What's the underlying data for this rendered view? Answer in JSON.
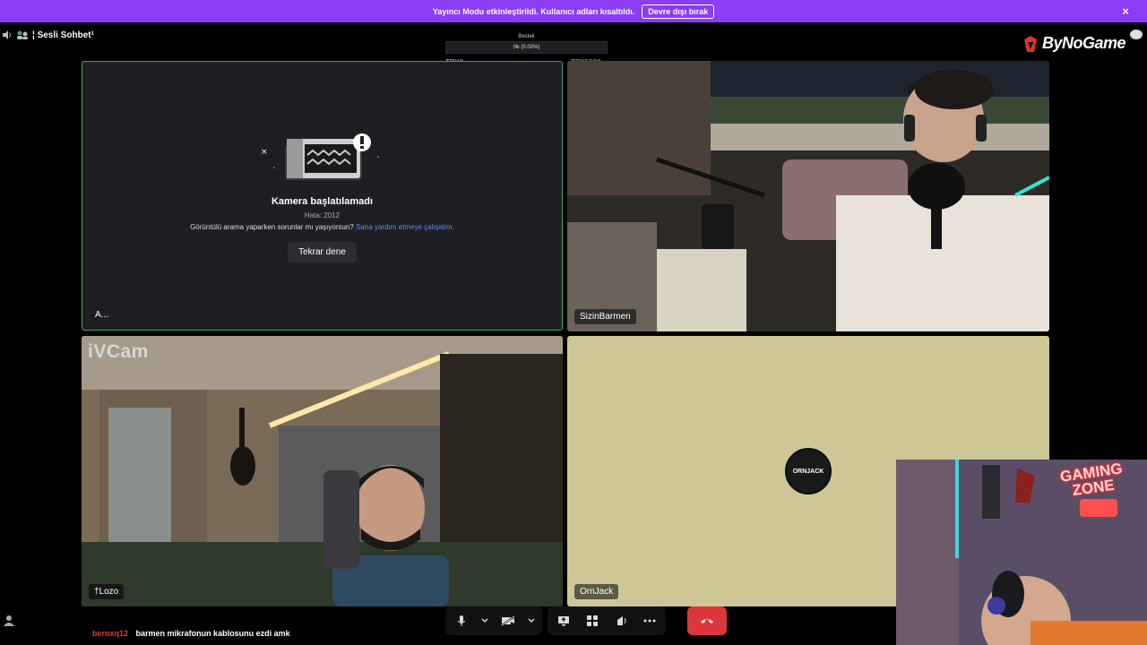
{
  "banner": {
    "text": "Yayıncı Modu etkinleştirildi. Kullanıcı adları kısaltıldı.",
    "button_label": "Devre dışı bırak",
    "close_icon": "×"
  },
  "channel": {
    "title": "¦ Sesli Sohbet¹"
  },
  "overlay": {
    "label": "Bestek",
    "value_text": "0₺ (0.00%)",
    "progress": 0,
    "left_label": "TRY0",
    "right_label": "TRY5000"
  },
  "logo": {
    "text": "ByNoGame"
  },
  "tiles": {
    "a": {
      "error_title": "Kamera başlatılamadı",
      "error_code": "Hata: 2012",
      "help_text": "Görüntülü arama yaparken sorunlar mı yaşıyorsun?",
      "help_link": "Sana yardım etmeye çalışalım.",
      "retry_label": "Tekrar dene",
      "name": "A..."
    },
    "b": {
      "name": "SizinBarmen"
    },
    "c": {
      "watermark": "iVCam",
      "name": "†Lozo"
    },
    "d": {
      "name": "OrnJack",
      "avatar_text": "ORNJACK"
    }
  },
  "pip": {
    "sign_line1": "GAMING",
    "sign_line2": "ZONE"
  },
  "chat": {
    "user": "beroxq12",
    "message": "barmen mikrafonun kablosunu ezdi amk"
  },
  "colors": {
    "banner": "#8a3df4",
    "speaking_border": "#3ba55d",
    "hangup": "#da373c",
    "link": "#5b8def",
    "tile_d_bg": "#cdc797"
  }
}
